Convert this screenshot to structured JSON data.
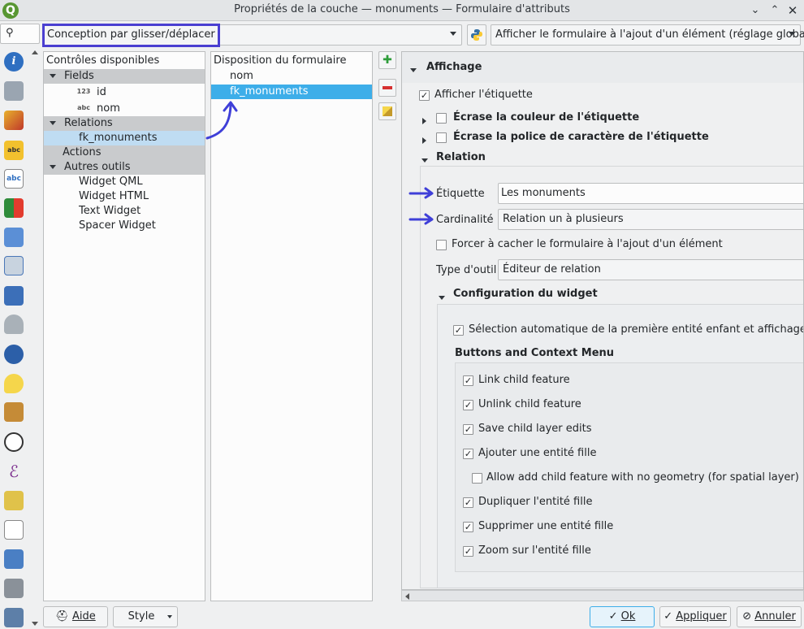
{
  "window": {
    "title": "Propriétés de la couche — monuments — Formulaire d'attributs"
  },
  "toolbar": {
    "search_placeholder": "",
    "editor_mode": "Conception par glisser/déplacer",
    "python_icon": "python-icon",
    "show_form_option": "Afficher le formulaire à l'ajout d'un élément (réglage globa"
  },
  "available_controls": {
    "header": "Contrôles disponibles",
    "groups": [
      {
        "label": "Fields",
        "items": [
          {
            "badge": "123",
            "label": "id"
          },
          {
            "badge": "abc",
            "label": "nom"
          }
        ]
      },
      {
        "label": "Relations",
        "items": [
          {
            "label": "fk_monuments"
          }
        ]
      },
      {
        "label": "Actions",
        "items": []
      },
      {
        "label": "Autres outils",
        "items": [
          {
            "label": "Widget QML"
          },
          {
            "label": "Widget HTML"
          },
          {
            "label": "Text Widget"
          },
          {
            "label": "Spacer Widget"
          }
        ]
      }
    ]
  },
  "form_layout": {
    "header": "Disposition du formulaire",
    "items": [
      "nom",
      "fk_monuments"
    ]
  },
  "properties": {
    "display_section": "Affichage",
    "show_label": "Afficher l'étiquette",
    "override_label_color": "Écrase la couleur de l'étiquette",
    "override_label_font": "Écrase la police de caractère de l'étiquette",
    "relation_section": "Relation",
    "label_caption": "Étiquette",
    "label_value": "Les monuments",
    "cardinality_caption": "Cardinalité",
    "cardinality_value": "Relation un à plusieurs",
    "force_hide_form": "Forcer à cacher le formulaire à l'ajout d'un élément",
    "tool_type_caption": "Type d'outil",
    "tool_type_value": "Éditeur de relation",
    "widget_config_section": "Configuration du widget",
    "auto_select": "Sélection automatique de la première entité enfant et affichage du f",
    "buttons_menu_header": "Buttons and Context Menu",
    "options": [
      {
        "label": "Link child feature",
        "checked": true
      },
      {
        "label": "Unlink child feature",
        "checked": true
      },
      {
        "label": "Save child layer edits",
        "checked": true
      },
      {
        "label": "Ajouter une entité fille",
        "checked": true
      },
      {
        "label": "Allow add child feature with no geometry (for spatial layer)",
        "checked": false
      },
      {
        "label": "Dupliquer l'entité fille",
        "checked": true
      },
      {
        "label": "Supprimer une entité fille",
        "checked": true
      },
      {
        "label": "Zoom sur l'entité fille",
        "checked": true
      }
    ]
  },
  "footer": {
    "help": "Aide",
    "style": "Style",
    "ok": "Ok",
    "apply": "Appliquer",
    "cancel": "Annuler"
  },
  "colors": {
    "highlight_box": "#4a3fd1",
    "annotation_arrow": "#3f3fd8",
    "selection": "#3daee9"
  }
}
